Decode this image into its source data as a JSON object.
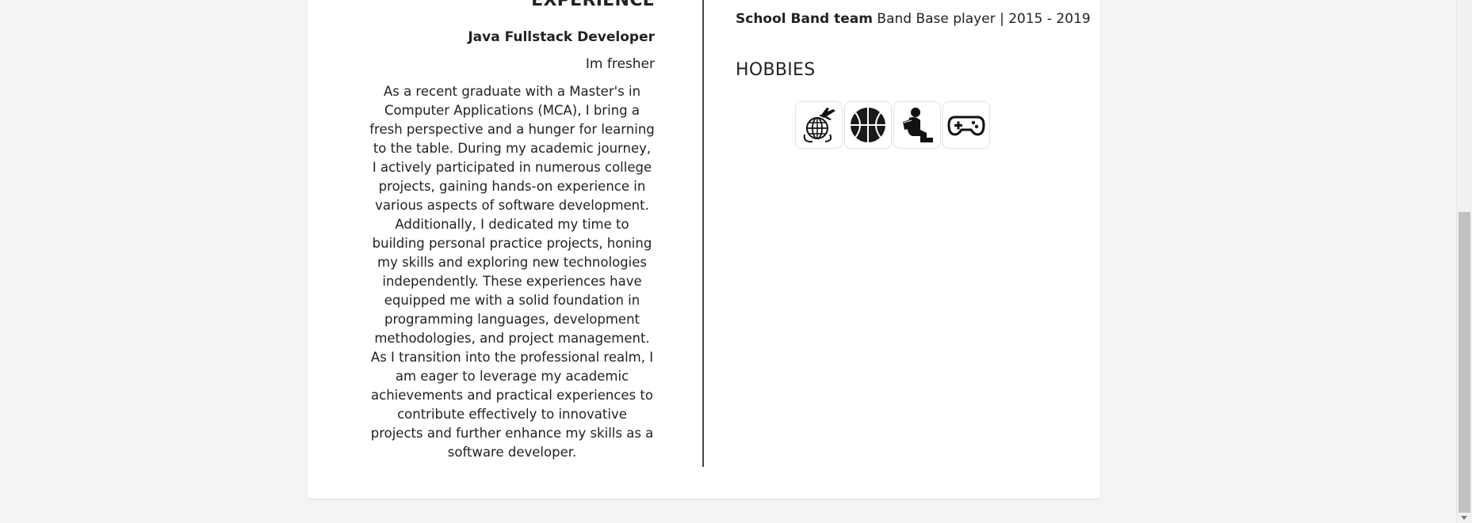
{
  "experience": {
    "section_title": "EXPERIENCE",
    "job_title": "Java Fullstack Developer",
    "job_subtitle": "Im fresher",
    "description": "As a recent graduate with a Master's in Computer Applications (MCA), I bring a fresh perspective and a hunger for learning to the table. During my academic journey, I actively participated in numerous college projects, gaining hands-on experience in various aspects of software development. Additionally, I dedicated my time to building personal practice projects, honing my skills and exploring new technologies independently. These experiences have equipped me with a solid foundation in programming languages, development methodologies, and project management. As I transition into the professional realm, I am eager to leverage my academic achievements and practical experiences to contribute effectively to innovative projects and further enhance my skills as a software developer."
  },
  "activities": {
    "team_name": "School Band team",
    "team_detail": "Band Base player | 2015 - 2019"
  },
  "hobbies": {
    "title": "HOBBIES",
    "items": [
      {
        "icon": "travel-globe-plane-icon"
      },
      {
        "icon": "basketball-icon"
      },
      {
        "icon": "reading-person-icon"
      },
      {
        "icon": "gamepad-icon"
      }
    ]
  }
}
